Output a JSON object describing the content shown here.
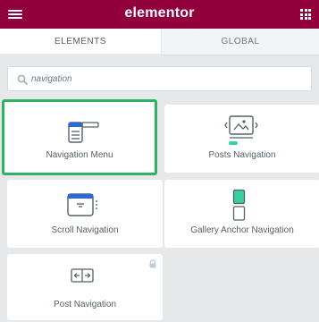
{
  "header": {
    "logo": "elementor",
    "menu_icon": "hamburger-icon",
    "apps_icon": "grid-icon"
  },
  "tabs": [
    {
      "label": "ELEMENTS",
      "active": true
    },
    {
      "label": "GLOBAL",
      "active": false
    }
  ],
  "search": {
    "value": "navigation",
    "icon": "search-icon"
  },
  "widgets": [
    {
      "label": "Navigation Menu",
      "icon": "nav-menu-icon",
      "selected": true,
      "locked": false
    },
    {
      "label": "Posts Navigation",
      "icon": "posts-navigation-icon",
      "selected": false,
      "locked": false
    },
    {
      "label": "Scroll Navigation",
      "icon": "scroll-navigation-icon",
      "selected": false,
      "locked": false
    },
    {
      "label": "Gallery Anchor Navigation",
      "icon": "gallery-anchor-icon",
      "selected": false,
      "locked": false
    },
    {
      "label": "Post Navigation",
      "icon": "post-navigation-icon",
      "selected": false,
      "locked": true
    }
  ],
  "colors": {
    "brand": "#92003b",
    "selected_border": "#2eb363",
    "accent_blue": "#2c6bd6",
    "accent_green": "#39d0a0"
  }
}
